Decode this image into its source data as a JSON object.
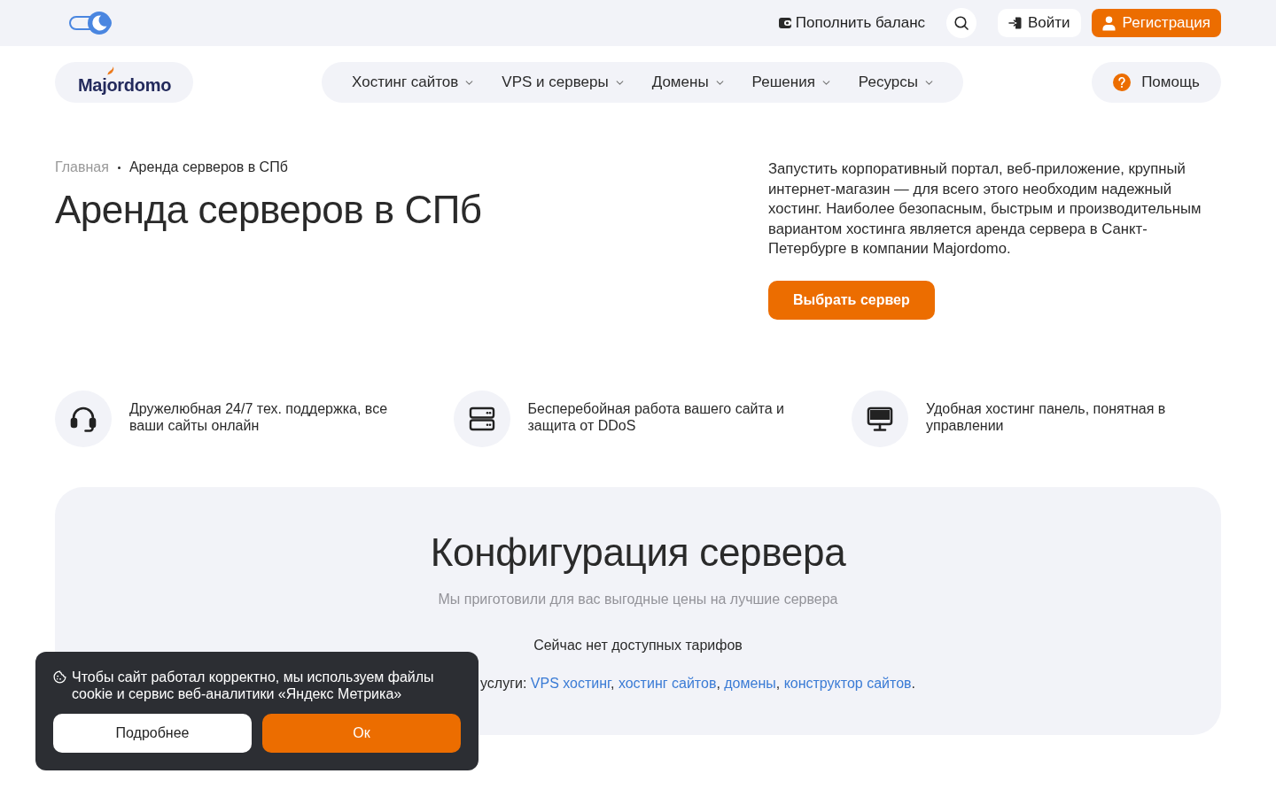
{
  "top_bar": {
    "theme_toggle": {
      "on": true
    },
    "top_up": "Пополнить баланс",
    "login": "Войти",
    "register": "Регистрация"
  },
  "header": {
    "logo": "Majordomo",
    "nav": [
      {
        "label": "Хостинг сайтов",
        "has_menu": true
      },
      {
        "label": "VPS и серверы",
        "has_menu": true
      },
      {
        "label": "Домены",
        "has_menu": true
      },
      {
        "label": "Решения",
        "has_menu": true
      },
      {
        "label": "Ресурсы",
        "has_menu": true
      }
    ],
    "help": "Помощь"
  },
  "breadcrumb": [
    {
      "label": "Главная",
      "current": false
    },
    {
      "label": "Аренда серверов в СПб",
      "current": true
    }
  ],
  "hero": {
    "title": "Аренда серверов в СПб",
    "description": "Запустить корпоративный портал, веб-приложение, крупный интернет-магазин — для всего этого необходим надежный хостинг. Наиболее безопасным, быстрым и производительным вариантом хостинга является аренда сервера в Санкт-Петербурге в компании Majordomo.",
    "button": "Выбрать сервер"
  },
  "features": [
    {
      "kind": "headset",
      "text": "Дружелюбная 24/7 тех. поддержка, все ваши сайты онлайн"
    },
    {
      "kind": "server",
      "text": "Бесперебойная работа вашего сайта и защита от DDoS"
    },
    {
      "kind": "monitor",
      "text": "Удобная хостинг панель, понятная в управлении"
    }
  ],
  "configuration": {
    "title": "Конфигурация сервера",
    "subtitle": "Мы приготовили для вас выгодные цены на лучшие сервера",
    "empty_message": "Сейчас нет доступных тарифов",
    "alternatives": [
      {
        "kind": "text",
        "text": "услуги: "
      },
      {
        "kind": "link",
        "text": "VPS хостинг"
      },
      {
        "kind": "text",
        "text": ", "
      },
      {
        "kind": "link",
        "text": "хостинг сайтов"
      },
      {
        "kind": "text",
        "text": ", "
      },
      {
        "kind": "link",
        "text": "домены"
      },
      {
        "kind": "text",
        "text": ", "
      },
      {
        "kind": "link",
        "text": "конструктор сайтов"
      },
      {
        "kind": "text",
        "text": "."
      }
    ]
  },
  "cookie_banner": {
    "text": "Чтобы сайт работал корректно, мы используем файлы cookie и сервис веб-аналитики «Яндекс Метрика»",
    "buttons": [
      {
        "label": "Подробнее",
        "kind": "secondary"
      },
      {
        "label": "Ок",
        "kind": "primary"
      }
    ]
  }
}
